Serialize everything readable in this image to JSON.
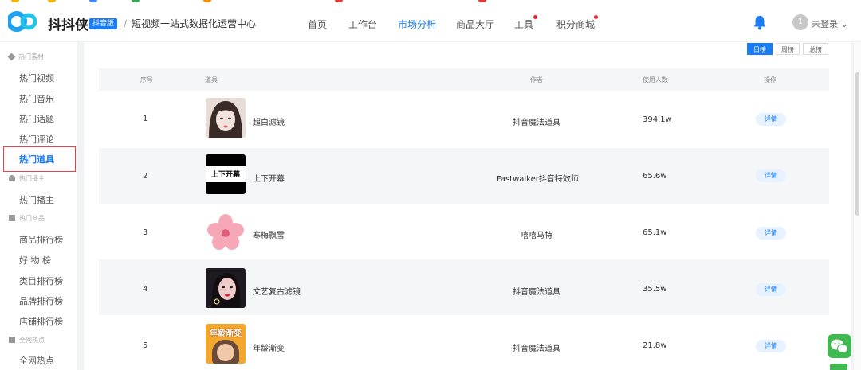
{
  "header": {
    "brand": "抖抖侠",
    "badge": "抖音版",
    "breadcrumb_sep": "/",
    "breadcrumb": "短视频一站式数据化运营中心",
    "nav": [
      "首页",
      "工作台",
      "市场分析",
      "商品大厅",
      "工具",
      "积分商城"
    ],
    "active_nav": "市场分析",
    "login_label": "未登录",
    "avatar_letter": "1",
    "accent_color": "#1a7cf5"
  },
  "sidebar": {
    "groups": [
      {
        "label": "热门素材",
        "items": [
          "热门视频",
          "热门音乐",
          "热门话题",
          "热门评论",
          "热门道具"
        ]
      },
      {
        "label": "热门播主",
        "items": [
          "热门播主"
        ]
      },
      {
        "label": "热门商品",
        "items": [
          "商品排行榜",
          "好 物 榜",
          "类目排行榜",
          "品牌排行榜",
          "店铺排行榜"
        ]
      },
      {
        "label": "全网热点",
        "items": [
          "全网热点"
        ]
      }
    ],
    "active_item": "热门道具"
  },
  "tabs": [
    "日榜",
    "周榜",
    "总榜"
  ],
  "active_tab": "日榜",
  "table": {
    "headers": [
      "序号",
      "道具",
      "作者",
      "使用人数",
      "操作"
    ],
    "rows": [
      {
        "index": "1",
        "name": "超白滤镜",
        "author": "抖音魔法道具",
        "users": "394.1w",
        "action": "详情",
        "thumb_text": ""
      },
      {
        "index": "2",
        "name": "上下开幕",
        "author": "Fastwalker抖音特效师",
        "users": "65.6w",
        "action": "详情",
        "thumb_text": "上下开幕"
      },
      {
        "index": "3",
        "name": "寒梅飘雪",
        "author": "嘻嘻马特",
        "users": "65.1w",
        "action": "详情",
        "thumb_text": ""
      },
      {
        "index": "4",
        "name": "文艺复古滤镜",
        "author": "抖音魔法道具",
        "users": "35.5w",
        "action": "详情",
        "thumb_text": ""
      },
      {
        "index": "5",
        "name": "年龄渐变",
        "author": "抖音魔法道具",
        "users": "21.8w",
        "action": "详情",
        "thumb_text": "年龄渐变"
      }
    ]
  }
}
